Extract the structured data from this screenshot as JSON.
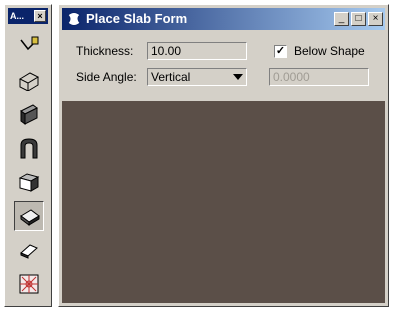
{
  "palette": {
    "title": "A...",
    "close_glyph": "×",
    "tools": [
      {
        "icon": "place-shape-tool-icon"
      },
      {
        "icon": "slab-wireframe-icon"
      },
      {
        "icon": "slab-solid-icon"
      },
      {
        "icon": "arch-icon"
      },
      {
        "icon": "box-icon"
      },
      {
        "icon": "place-slab-icon",
        "active": true
      },
      {
        "icon": "eraser-icon"
      },
      {
        "icon": "grid-target-icon"
      }
    ]
  },
  "window": {
    "title": "Place Slab Form",
    "minimize": "_",
    "maximize": "□",
    "close": "×"
  },
  "form": {
    "thickness_label": "Thickness:",
    "thickness_value": "10.00",
    "below_shape_label": "Below Shape",
    "below_shape_checked": "✓",
    "side_angle_label": "Side Angle:",
    "side_angle_value": "Vertical",
    "angle_value": "0.0000"
  },
  "colors": {
    "title_start": "#0a246a",
    "title_end": "#a6caf0",
    "view_bg": "#5b4f48",
    "chrome": "#d4d0c8"
  }
}
